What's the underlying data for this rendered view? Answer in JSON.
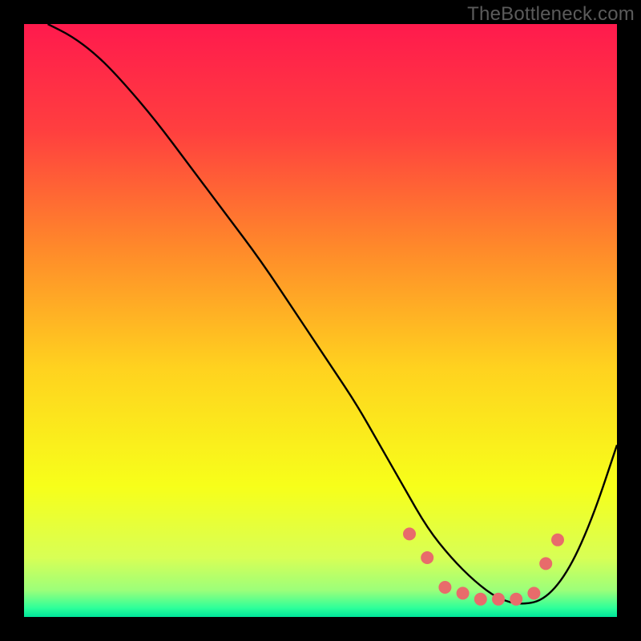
{
  "watermark": "TheBottleneck.com",
  "chart_data": {
    "type": "line",
    "title": "",
    "xlabel": "",
    "ylabel": "",
    "xlim": [
      0,
      100
    ],
    "ylim": [
      0,
      100
    ],
    "grid": false,
    "background": {
      "type": "vertical-gradient",
      "stops": [
        {
          "pos": 0.0,
          "color": "#ff1a4d"
        },
        {
          "pos": 0.18,
          "color": "#ff3f3f"
        },
        {
          "pos": 0.38,
          "color": "#ff8a2a"
        },
        {
          "pos": 0.58,
          "color": "#ffd21f"
        },
        {
          "pos": 0.78,
          "color": "#f7ff1a"
        },
        {
          "pos": 0.9,
          "color": "#d8ff55"
        },
        {
          "pos": 0.955,
          "color": "#9cff7a"
        },
        {
          "pos": 0.985,
          "color": "#2dff9a"
        },
        {
          "pos": 1.0,
          "color": "#00e59a"
        }
      ]
    },
    "series": [
      {
        "name": "curve",
        "color": "#000000",
        "x": [
          4,
          8,
          12,
          16,
          22,
          28,
          34,
          40,
          46,
          52,
          56,
          60,
          64,
          68,
          72,
          76,
          80,
          84,
          88,
          92,
          96,
          100
        ],
        "y": [
          100,
          98,
          95,
          91,
          84,
          76,
          68,
          60,
          51,
          42,
          36,
          29,
          22,
          15,
          10,
          6,
          3,
          2,
          3,
          8,
          17,
          29
        ]
      }
    ],
    "markers": {
      "name": "highlight-dots",
      "color": "#e86b6b",
      "radius": 8,
      "points": [
        {
          "x": 65,
          "y": 14
        },
        {
          "x": 68,
          "y": 10
        },
        {
          "x": 71,
          "y": 5
        },
        {
          "x": 74,
          "y": 4
        },
        {
          "x": 77,
          "y": 3
        },
        {
          "x": 80,
          "y": 3
        },
        {
          "x": 83,
          "y": 3
        },
        {
          "x": 86,
          "y": 4
        },
        {
          "x": 88,
          "y": 9
        },
        {
          "x": 90,
          "y": 13
        }
      ]
    }
  }
}
